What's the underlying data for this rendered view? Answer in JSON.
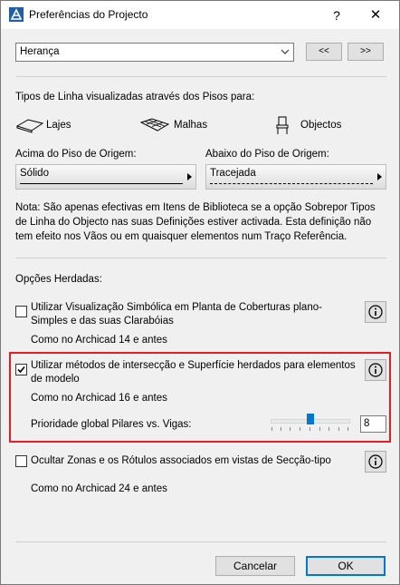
{
  "window": {
    "title": "Preferências do Projecto",
    "help_label": "?",
    "close_label": "✕"
  },
  "top": {
    "dropdown_value": "Herança",
    "prev_label": "<<",
    "next_label": ">>"
  },
  "line_types": {
    "heading": "Tipos de Linha visualizadas através dos Pisos para:",
    "items": [
      {
        "label": "Lajes",
        "icon": "slab-icon"
      },
      {
        "label": "Malhas",
        "icon": "mesh-icon"
      },
      {
        "label": "Objectos",
        "icon": "object-chair-icon"
      }
    ],
    "above_label": "Acima do Piso de Origem:",
    "above_value": "Sólido",
    "below_label": "Abaixo do Piso de Origem:",
    "below_value": "Tracejada",
    "note": "Nota: São apenas efectivas em Itens de Biblioteca se a opção Sobrepor Tipos de Linha do Objecto nas suas Definições estiver activada. Esta definição não tem efeito nos Vãos ou em quaisquer elementos num Traço Referência."
  },
  "inherited": {
    "heading": "Opções Herdadas:",
    "options": [
      {
        "label": "Utilizar Visualização Simbólica em Planta de Coberturas plano-Simples e das suas Clarabóias",
        "checked": false,
        "note": "Como no Archicad 14 e antes"
      },
      {
        "label": "Utilizar métodos de intersecção e Superfície herdados para elementos de modelo",
        "checked": true,
        "note": "Como no Archicad 16 e antes",
        "priority_label": "Prioridade global Pilares vs. Vigas:",
        "priority_value": "8",
        "slider_fraction": 0.5
      },
      {
        "label": "Ocultar Zonas e os Rótulos associados em vistas de Secção-tipo",
        "checked": false,
        "note": "Como no Archicad 24 e antes"
      }
    ]
  },
  "footer": {
    "cancel_label": "Cancelar",
    "ok_label": "OK"
  },
  "colors": {
    "highlight": "#e31e24",
    "accent": "#0078d7"
  }
}
